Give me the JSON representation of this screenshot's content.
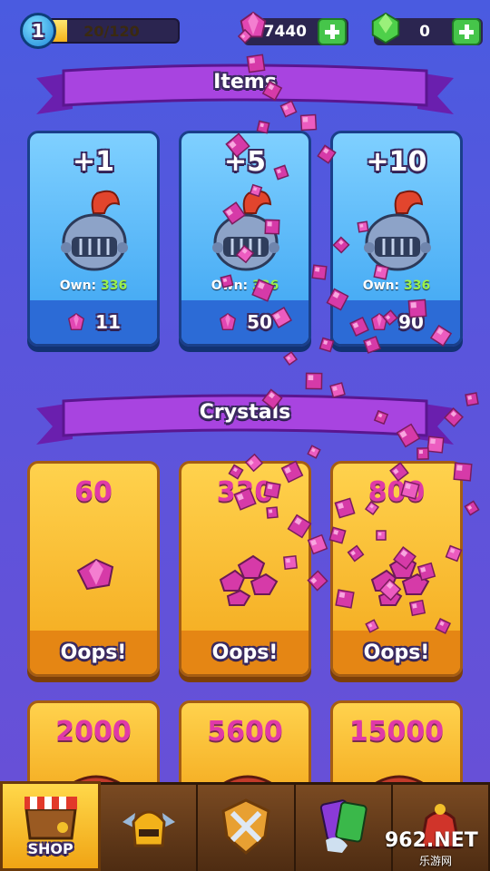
{
  "top_bar": {
    "level": "1",
    "xp_text": "20/120",
    "xp_fraction": 0.167,
    "coins": "7440",
    "gems": "0"
  },
  "sections": {
    "items_title": "Items",
    "crystals_title": "Crystals"
  },
  "items": [
    {
      "qty": "+1",
      "own_label": "Own:",
      "own_value": "336",
      "price": "11"
    },
    {
      "qty": "+5",
      "own_label": "Own:",
      "own_value": "336",
      "price": "50"
    },
    {
      "qty": "+10",
      "own_label": "Own:",
      "own_value": "336",
      "price": "90"
    }
  ],
  "crystals": [
    {
      "amount": "60",
      "button": "Oops!"
    },
    {
      "amount": "330",
      "button": "Oops!"
    },
    {
      "amount": "800",
      "button": "Oops!"
    },
    {
      "amount": "2000"
    },
    {
      "amount": "5600"
    },
    {
      "amount": "15000"
    }
  ],
  "nav": {
    "tabs": [
      {
        "label": "SHOP",
        "icon": "shop-chest-icon",
        "active": true
      },
      {
        "label": "",
        "icon": "hero-helmet-icon"
      },
      {
        "label": "",
        "icon": "battle-shield-icon"
      },
      {
        "label": "",
        "icon": "cards-icon"
      },
      {
        "label": "",
        "icon": "potion-bag-icon"
      }
    ]
  },
  "watermark": {
    "text": "962.NET",
    "sub": "乐游网"
  },
  "colors": {
    "background": "#5a55dc",
    "item_card": "#3aa3f2",
    "crystal_card": "#f3a81c",
    "crystal_text": "#e03aa8",
    "gem_magenta": "#d63aa8",
    "ribbon_purple": "#9a3ad8"
  }
}
